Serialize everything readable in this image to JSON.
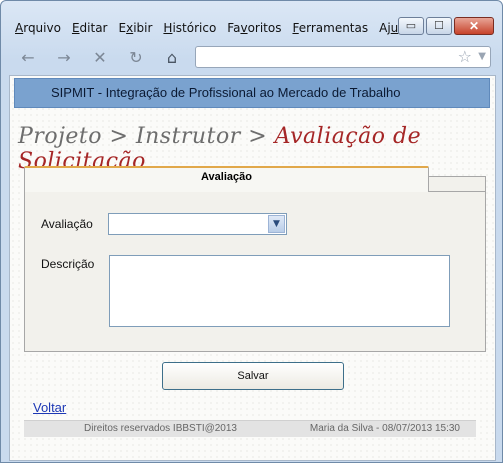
{
  "menu": {
    "items": [
      {
        "pre": "",
        "key": "A",
        "post": "rquivo"
      },
      {
        "pre": "",
        "key": "E",
        "post": "ditar"
      },
      {
        "pre": "E",
        "key": "x",
        "post": "ibir"
      },
      {
        "pre": "",
        "key": "H",
        "post": "istórico"
      },
      {
        "pre": "Fa",
        "key": "v",
        "post": "oritos"
      },
      {
        "pre": "",
        "key": "F",
        "post": "erramentas"
      },
      {
        "pre": "Aj",
        "key": "u",
        "post": "da"
      }
    ]
  },
  "window_controls": {
    "minimize": "▭",
    "maximize": "☐",
    "close": "✕"
  },
  "nav": {
    "back_icon": "←",
    "forward_icon": "→",
    "stop_icon": "✕",
    "reload_icon": "↻",
    "home_icon": "⌂",
    "url": "",
    "star_icon": "☆",
    "dropdown_icon": "▼"
  },
  "app": {
    "header_title": "SIPMIT - Integração de Profissional ao Mercado de Trabalho"
  },
  "breadcrumb": {
    "part1": "Projeto",
    "sep1": " > ",
    "part2": "Instrutor",
    "sep2": " > ",
    "current": "Avaliação de Solicitação"
  },
  "form": {
    "tab_label": "Avaliação",
    "avaliacao_label": "Avaliação",
    "avaliacao_value": "",
    "descricao_label": "Descrição",
    "descricao_value": "",
    "select_arrow": "▼",
    "save_label": "Salvar"
  },
  "back_link": "Voltar",
  "footer": {
    "left": "Direitos reservados IBBSTI@2013",
    "right": "Maria da Silva - 08/07/2013 15:30"
  },
  "colors": {
    "header_bar": "#7aa2cf",
    "breadcrumb_current": "#a52626",
    "tab_accent": "#e1a84a",
    "link": "#1d38b5"
  }
}
